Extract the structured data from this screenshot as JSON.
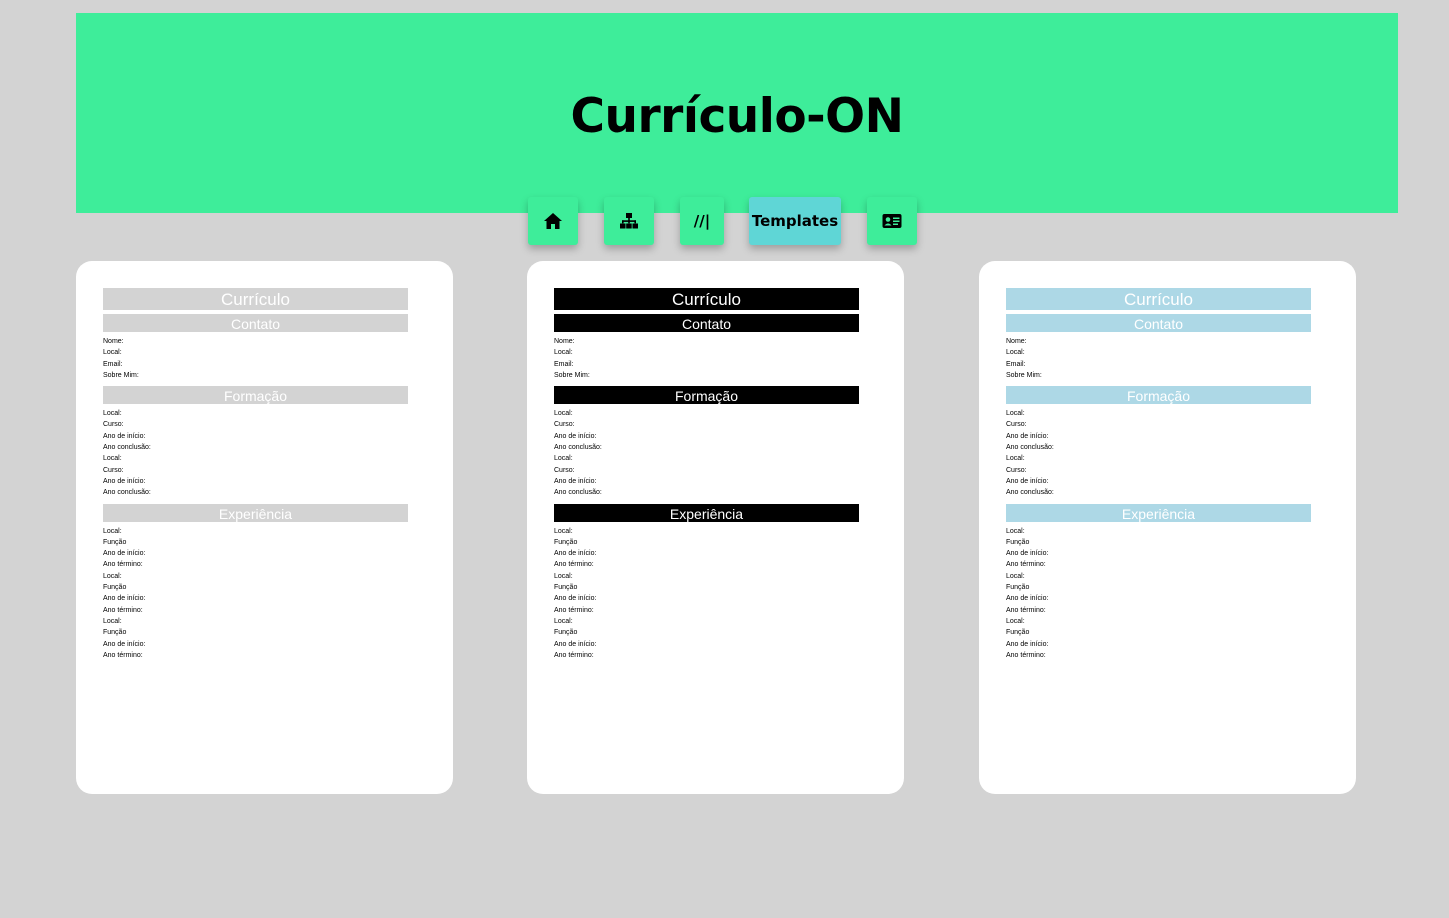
{
  "header": {
    "title": "Currículo-ON"
  },
  "nav": {
    "home_icon": "home-icon",
    "sitemap_icon": "sitemap-icon",
    "slashes_label": "//|",
    "templates_label": "Templates",
    "contact_card_icon": "id-card-icon"
  },
  "colors": {
    "header_bg": "#3eed9a",
    "nav_active": "#5fd6d6",
    "page_bg": "#d3d3d3",
    "template_gray": "#d3d3d3",
    "template_black": "#000000",
    "template_blue": "#add8e6"
  },
  "resume": {
    "title": "Currículo",
    "contact_heading": "Contato",
    "contact_fields": [
      "Nome:",
      "Local:",
      "Email:",
      "Sobre Mim:"
    ],
    "education_heading": "Formação",
    "education_fields": [
      "Local:",
      "Curso:",
      "Ano de início:",
      "Ano conclusão:",
      "Local:",
      "Curso:",
      "Ano de início:",
      "Ano conclusão:"
    ],
    "experience_heading": "Experiência",
    "experience_fields": [
      "Local:",
      "Função",
      "Ano de início:",
      "Ano término:",
      "Local:",
      "Função",
      "Ano de início:",
      "Ano término:",
      "Local:",
      "Função",
      "Ano de início:",
      "Ano término:"
    ]
  },
  "templates": [
    {
      "name": "gray",
      "bar_color": "#d3d3d3"
    },
    {
      "name": "black",
      "bar_color": "#000000"
    },
    {
      "name": "blue",
      "bar_color": "#add8e6"
    }
  ]
}
